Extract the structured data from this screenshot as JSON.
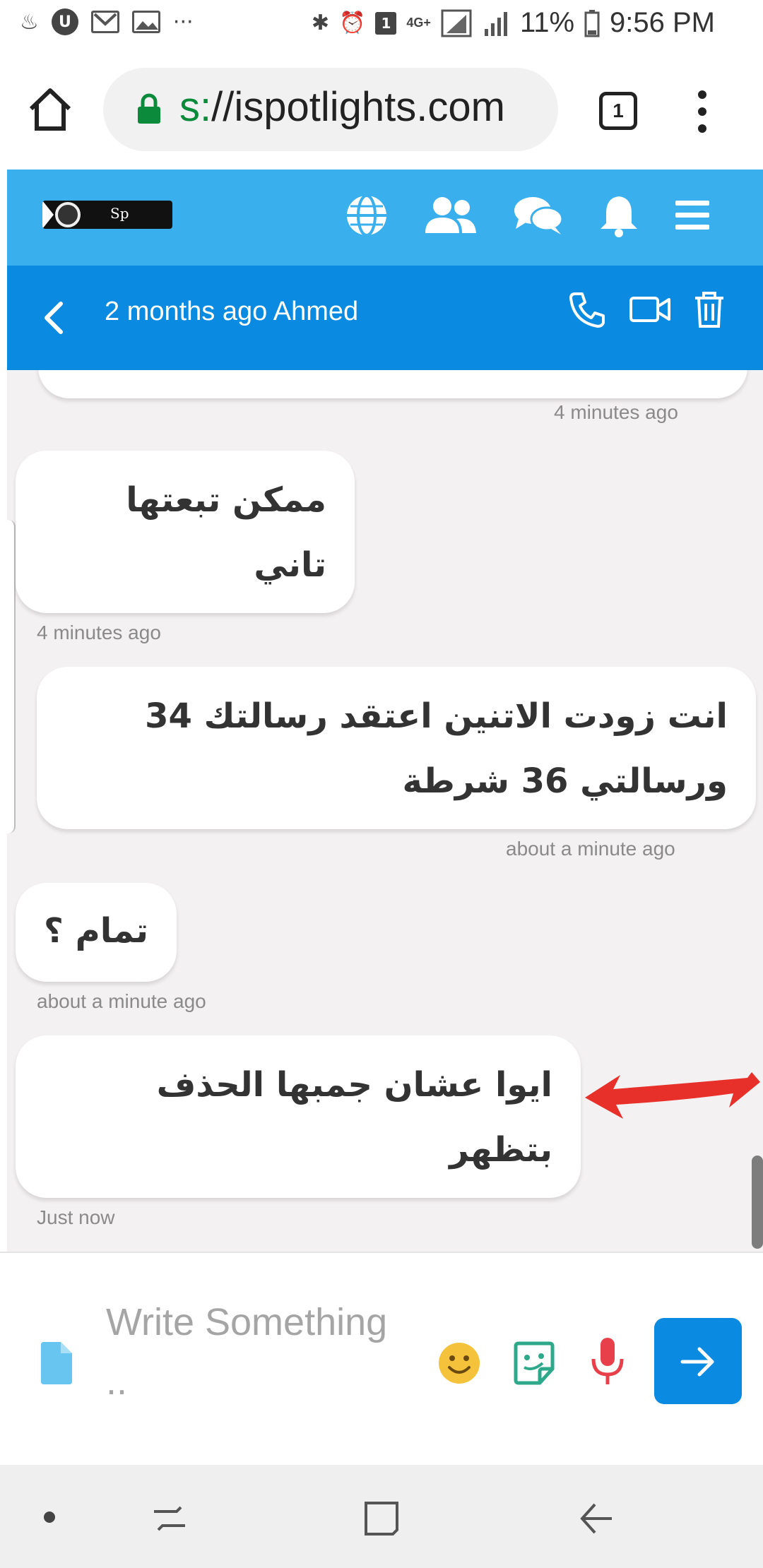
{
  "status_bar": {
    "left_icons": [
      "notification-icon",
      "u-icon",
      "gmail-icon",
      "gallery-icon",
      "more-notifications-icon"
    ],
    "more_text": "···",
    "badge": "1",
    "network": "4G+",
    "battery": "11%",
    "time": "9:56 PM"
  },
  "browser": {
    "url_scheme": "s:",
    "url_rest": "//ispotlights.com",
    "tab_count": "1"
  },
  "site_nav": {
    "logo_text": "Sp",
    "icons": [
      "globe-icon",
      "people-icon",
      "chat-icon",
      "bell-icon",
      "hamburger-menu-icon"
    ]
  },
  "chat_header": {
    "title": "2 months ago Ahmed",
    "actions": [
      "phone-icon",
      "video-icon",
      "trash-icon"
    ]
  },
  "messages": [
    {
      "side": "right",
      "text": "",
      "time": "4 minutes ago"
    },
    {
      "side": "left",
      "text": "ممكن تبعتها تاني",
      "time": "4 minutes ago"
    },
    {
      "side": "right",
      "text": "انت زودت الاتنين اعتقد رسالتك 34 ورسالتي 36 شرطة",
      "time": "about a minute ago"
    },
    {
      "side": "left",
      "text": "تمام ؟",
      "time": "about a minute ago"
    },
    {
      "side": "left",
      "text": "ايوا عشان جمبها الحذف بتظهر",
      "time": "Just now"
    }
  ],
  "annotation": {
    "arrow_color": "#e8302a"
  },
  "composer": {
    "placeholder": "Write Something ..",
    "send_icon": "arrow-right-icon"
  },
  "colors": {
    "navbar": "#3aafee",
    "chat_header": "#0a8ae0",
    "chat_background": "#f4f1f2",
    "send_button": "#0a8ae0",
    "secure_lock": "#0a8a3a"
  }
}
